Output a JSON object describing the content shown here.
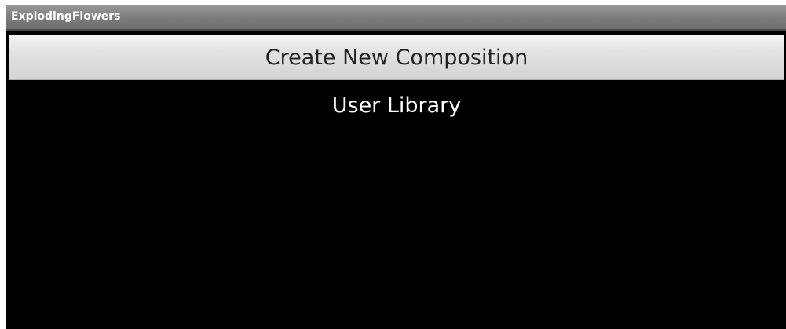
{
  "window": {
    "title": "ExplodingFlowers"
  },
  "menu": {
    "items": [
      {
        "label": "Create New Composition",
        "selected": true
      },
      {
        "label": "User Library",
        "selected": false
      }
    ]
  },
  "colors": {
    "background": "#000000",
    "titlebar": "#7c7c7c",
    "selected_item": "#e2e2e2",
    "normal_text": "#ffffff"
  }
}
